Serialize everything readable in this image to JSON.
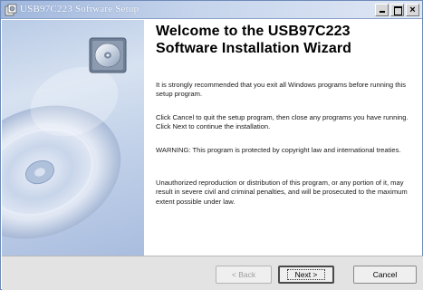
{
  "window": {
    "title": "USB97C223 Software Setup",
    "title_color": "#ffffff",
    "titlebar_colors": [
      "#9fb6dc",
      "#dfe7f4"
    ]
  },
  "icons": {
    "app": "setup-app-icon",
    "minimize": "minimize-icon",
    "maximize": "maximize-icon",
    "close": "close-icon",
    "cd_small": "cd-disc-icon",
    "cd_large": "cd-disc-illustration"
  },
  "main": {
    "heading_line1": "Welcome to the USB97C223",
    "heading_line2": "Software Installation Wizard",
    "paragraphs": [
      "It is strongly recommended that you exit all Windows programs before running this setup program.",
      "Click Cancel to quit the setup program, then close any programs you have running.  Click Next to continue the installation.",
      "WARNING: This program is protected by copyright law and international treaties.",
      "Unauthorized reproduction or distribution of this program, or any portion of it, may result in severe civil and criminal penalties, and will be prosecuted to the maximum extent possible under law."
    ]
  },
  "footer": {
    "back_label": "< Back",
    "next_label": "Next >",
    "cancel_label": "Cancel"
  }
}
